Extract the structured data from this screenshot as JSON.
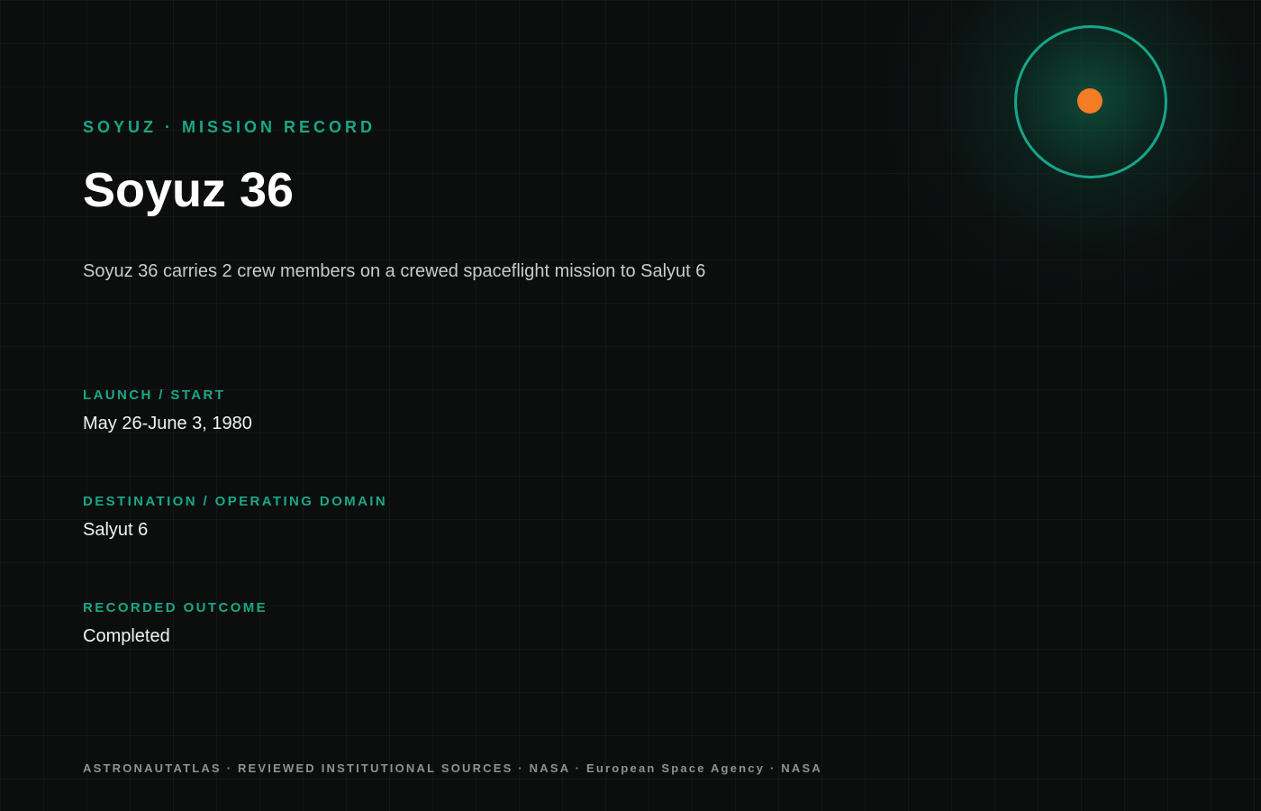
{
  "header": {
    "eyebrow": "SOYUZ · MISSION RECORD",
    "title": "Soyuz 36"
  },
  "description": "Soyuz 36 carries 2 crew members on a crewed spaceflight mission to Salyut 6",
  "fields": [
    {
      "label": "LAUNCH / START",
      "value": "May 26-June 3, 1980"
    },
    {
      "label": "DESTINATION / OPERATING DOMAIN",
      "value": "Salyut 6"
    },
    {
      "label": "RECORDED OUTCOME",
      "value": "Completed"
    }
  ],
  "footer": {
    "sources": "ASTRONAUTATLAS · REVIEWED INSTITUTIONAL SOURCES · NASA · European Space Agency · NASA"
  },
  "emblem": {
    "icon": "orbit-icon",
    "ring_color": "#17a589",
    "dot_color": "#f47c24"
  },
  "colors": {
    "background": "#0c0e0e",
    "accent": "#19a886"
  }
}
